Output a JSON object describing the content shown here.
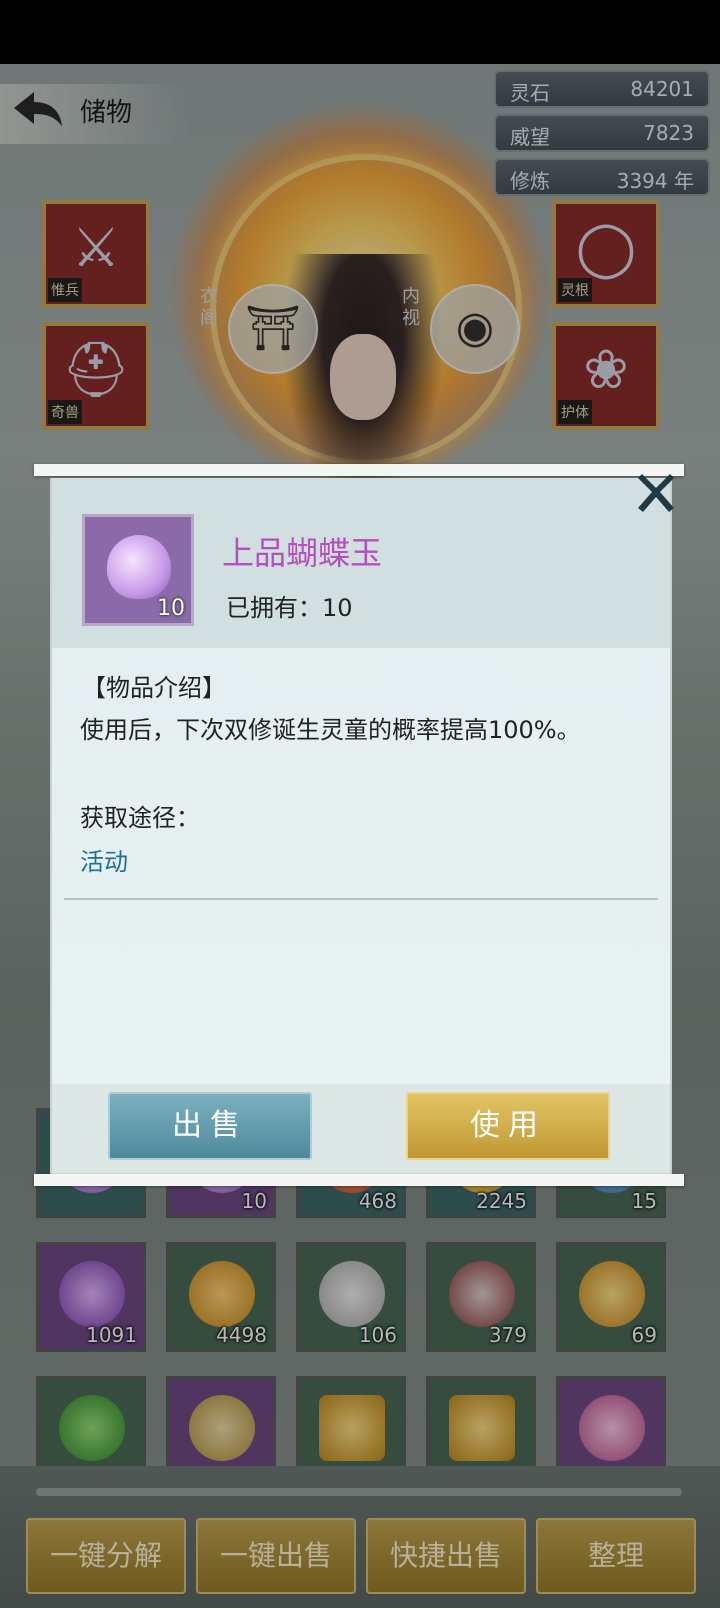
{
  "header": {
    "title": "储物"
  },
  "stats": [
    {
      "label": "灵石",
      "value": "84201"
    },
    {
      "label": "威望",
      "value": "7823"
    },
    {
      "label": "修炼",
      "value": "3394 年"
    }
  ],
  "equipment": {
    "left": [
      {
        "tag": "惟兵"
      },
      {
        "tag": "奇兽"
      }
    ],
    "right": [
      {
        "tag": "灵根"
      },
      {
        "tag": "护体"
      }
    ]
  },
  "side_buttons": {
    "left_label": "衣阁",
    "right_label": "内视"
  },
  "dialog": {
    "item_name": "上品蝴蝶玉",
    "item_count": "10",
    "owned_text": "已拥有：10",
    "intro_heading": "【物品介绍】",
    "description": "使用后，下次双修诞生灵童的概率提高100%。",
    "source_heading": "获取途径：",
    "source_value": "活动",
    "sell_label": "出售",
    "use_label": "使用"
  },
  "inventory": {
    "row1": [
      {
        "count": "",
        "color": "teal"
      },
      {
        "count": "10",
        "color": "purple"
      },
      {
        "count": "468",
        "color": "teal"
      },
      {
        "count": "2245",
        "color": "teal"
      },
      {
        "count": "15",
        "color": "green"
      }
    ],
    "row2": [
      {
        "count": "1091",
        "color": "purple"
      },
      {
        "count": "4498",
        "color": "green"
      },
      {
        "count": "106",
        "color": "green"
      },
      {
        "count": "379",
        "color": "green"
      },
      {
        "count": "69",
        "color": "green"
      }
    ],
    "row3": [
      {
        "count": "",
        "color": "green"
      },
      {
        "count": "",
        "color": "purple"
      },
      {
        "count": "",
        "color": "green"
      },
      {
        "count": "",
        "color": "green"
      },
      {
        "count": "",
        "color": "purple"
      }
    ]
  },
  "bottom_buttons": {
    "decompose_all": "一键分解",
    "sell_all": "一键出售",
    "quick_sell": "快捷出售",
    "sort": "整理"
  }
}
